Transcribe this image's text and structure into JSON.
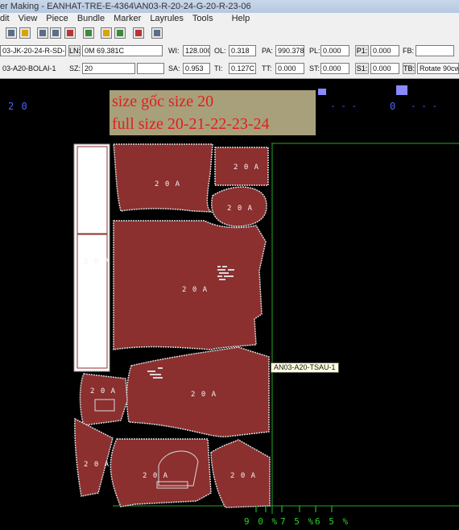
{
  "titlebar": {
    "text": "er Making - EANHAT-TRE-E-4364\\AN03-R-20-24-G-20-R-23-06"
  },
  "menu": [
    "dit",
    "View",
    "Piece",
    "Bundle",
    "Marker",
    "Layrules",
    "Tools",
    "Help"
  ],
  "panel": {
    "row1_name": "03-JK-20-24-R-SD-23-06",
    "ln_label": "LN:",
    "ln_value": "0M 69.381C",
    "wi_label": "WI:",
    "wi_value": "128.000",
    "ol_label": "OL:",
    "ol_value": "0.318",
    "pa_label": "PA:",
    "pa_value": "990.378",
    "pl_label": "PL:",
    "pl_value": "0.000",
    "p1_label": "P1:",
    "p1_value": "0.000",
    "fb_label": "FB:",
    "fb_value": "",
    "row2_name": "03-A20-BOLAI-1",
    "sz_label": "SZ:",
    "sz_value": "20",
    "sa_label": "SA:",
    "sa_value": "0.953",
    "ti_label": "TI:",
    "ti_value": "0.127C",
    "tt_label": "TT:",
    "tt_value": "0.000",
    "st_label": "ST:",
    "st_value": "0.000",
    "s1_label": "S1:",
    "s1_value": "0.000",
    "tb_label": "TB:",
    "tb_value": "Rotate 90cw"
  },
  "canvas": {
    "top_size_left": "2 0",
    "top_size_right": "0",
    "dashes": "- - -",
    "annotation_line1": "size gốc size  20",
    "annotation_line2": "full size  20-21-22-23-24",
    "piece_label": "2 0  A",
    "tooltip": "AN03-A20-TSAU-1",
    "percent_1": "9 0 %",
    "percent_2": "7 5 %",
    "percent_3": "6 5 %"
  },
  "colors": {
    "piece_fill": "#8c2f2f",
    "piece_stroke": "#d8d8d8",
    "boundary": "#22aa22",
    "size_text": "#4a64ff",
    "annotation_text": "#e21e1e",
    "annotation_bg": "#a8a07a"
  },
  "icons": [
    "save-icon",
    "open-icon",
    "zoom-icon",
    "rectangle-icon",
    "grid-icon",
    "layout-icon",
    "folder-icon",
    "add-icon",
    "bundle-icon",
    "rotate-icon"
  ]
}
